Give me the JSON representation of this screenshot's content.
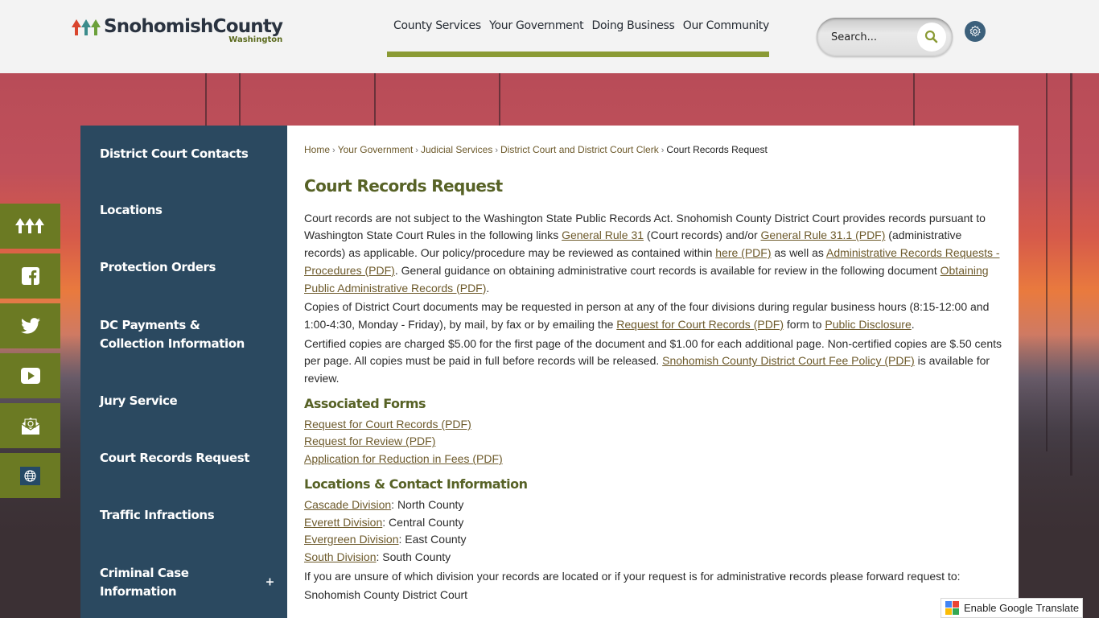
{
  "header": {
    "logo_name": "SnohomishCounty",
    "logo_sub": "Washington",
    "nav": [
      "County Services",
      "Your Government",
      "Doing Business",
      "Our Community"
    ],
    "search_placeholder": "Search...",
    "search_icon": "search-icon",
    "settings_icon": "gear-icon"
  },
  "social": [
    {
      "name": "county-logo",
      "icon": "trees-icon"
    },
    {
      "name": "facebook",
      "icon": "facebook-icon"
    },
    {
      "name": "twitter",
      "icon": "twitter-icon"
    },
    {
      "name": "youtube",
      "icon": "youtube-icon"
    },
    {
      "name": "email",
      "icon": "email-icon"
    },
    {
      "name": "translate",
      "icon": "globe-icon"
    }
  ],
  "sidebar": {
    "items": [
      {
        "label": "District Court Contacts"
      },
      {
        "label": "Locations"
      },
      {
        "label": "Protection Orders"
      },
      {
        "label": "DC Payments & Collection Information"
      },
      {
        "label": "Jury Service"
      },
      {
        "label": "Court Records Request"
      },
      {
        "label": "Traffic Infractions"
      },
      {
        "label": "Criminal Case Information",
        "expand": "+"
      }
    ]
  },
  "breadcrumb": {
    "items": [
      "Home",
      "Your Government",
      "Judicial Services",
      "District Court and District Court Clerk"
    ],
    "separator": "›",
    "current": "Court Records Request"
  },
  "page": {
    "title": "Court Records Request",
    "p1": {
      "t1": "Court records are not subject to the Washington State Public Records Act. Snohomish County District Court provides records pursuant to Washington State Court Rules in the following links ",
      "l1": "General Rule 31",
      "t2": " (Court records) and/or ",
      "l2": "General Rule 31.1 (PDF)",
      "t3": " (administrative records) as applicable. Our policy/procedure may be reviewed as contained within ",
      "l3": "here (PDF)",
      "t4": " as well as ",
      "l4": "Administrative Records Requests - Procedures (PDF)",
      "t5": ". General guidance on obtaining administrative court records is available for review in the following document ",
      "l5": "Obtaining Public Administrative Records (PDF)",
      "t6": "."
    },
    "p2": {
      "t1": "Copies of District Court documents may be requested in person at any of the four divisions during regular business hours (8:15-12:00 and 1:00-4:30, Monday - Friday), by mail, by fax or by emailing the ",
      "l1": "Request for Court Records (PDF)",
      "t2": " form to ",
      "l2": "Public Disclosure",
      "t3": "."
    },
    "p3": {
      "t1": "Certified copies are charged $5.00 for the first page of the document and $1.00 for each additional page. Non-certified copies are $.50 cents per page. All copies must be paid in full before records will be released. ",
      "l1": "Snohomish County District Court Fee Policy (PDF)",
      "t2": " is available for review."
    },
    "forms_heading": "Associated Forms",
    "forms": [
      "Request for Court Records (PDF)",
      "Request for Review (PDF)",
      "Application for Reduction in Fees (PDF)"
    ],
    "locations_heading": "Locations & Contact Information",
    "locations": [
      {
        "link": "Cascade Division",
        "area": ": North County"
      },
      {
        "link": "Everett Division",
        "area": ": Central County"
      },
      {
        "link": "Evergreen Division",
        "area": ": East County"
      },
      {
        "link": "South Division",
        "area": ": South County"
      }
    ],
    "unsure_text": "If you are unsure of which division your records are located or if your request is for administrative records please forward request to:",
    "address_line1": "Snohomish County District Court"
  },
  "google_translate": {
    "label": "Enable Google Translate"
  },
  "colors": {
    "accent_green": "#8a9a34",
    "social_green": "#6b7a23",
    "sidebar_blue": "#2b4960",
    "heading_olive": "#576226",
    "link_brown": "#6d5a2b"
  }
}
